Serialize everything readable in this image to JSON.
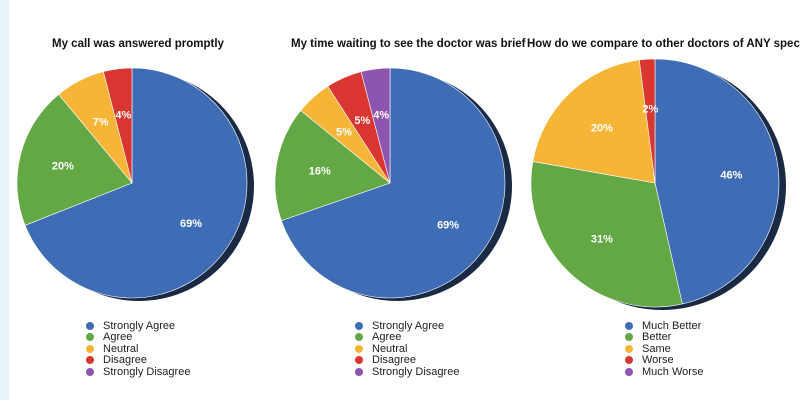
{
  "chart_data": [
    {
      "type": "pie",
      "title": "My call was answered promptly",
      "slices": [
        {
          "label": "Strongly Agree",
          "value": 69,
          "display": "69%",
          "color": "#3e6db5"
        },
        {
          "label": "Agree",
          "value": 20,
          "display": "20%",
          "color": "#63a845"
        },
        {
          "label": "Neutral",
          "value": 7,
          "display": "7%",
          "color": "#f6b536"
        },
        {
          "label": "Disagree",
          "value": 4,
          "display": "4%",
          "color": "#d93631"
        },
        {
          "label": "Strongly Disagree",
          "value": 0,
          "display": "",
          "color": "#8e55b0"
        }
      ],
      "legend_position": "bottom"
    },
    {
      "type": "pie",
      "title": "My time waiting to see the doctor was brief",
      "slices": [
        {
          "label": "Strongly Agree",
          "value": 69,
          "display": "69%",
          "color": "#3e6db5"
        },
        {
          "label": "Agree",
          "value": 16,
          "display": "16%",
          "color": "#63a845"
        },
        {
          "label": "Neutral",
          "value": 5,
          "display": "5%",
          "color": "#f6b536"
        },
        {
          "label": "Disagree",
          "value": 5,
          "display": "5%",
          "color": "#d93631"
        },
        {
          "label": "Strongly Disagree",
          "value": 4,
          "display": "4%",
          "color": "#8e55b0"
        }
      ],
      "legend_position": "bottom"
    },
    {
      "type": "pie",
      "title": "How do we compare to other doctors of ANY speciality",
      "slices": [
        {
          "label": "Much Better",
          "value": 46,
          "display": "46%",
          "color": "#3e6db5"
        },
        {
          "label": "Better",
          "value": 31,
          "display": "31%",
          "color": "#63a845"
        },
        {
          "label": "Same",
          "value": 20,
          "display": "20%",
          "color": "#f6b536"
        },
        {
          "label": "Worse",
          "value": 2,
          "display": "2%",
          "color": "#d93631"
        },
        {
          "label": "Much Worse",
          "value": 0,
          "display": "",
          "color": "#8e55b0"
        }
      ],
      "legend_position": "bottom"
    }
  ]
}
